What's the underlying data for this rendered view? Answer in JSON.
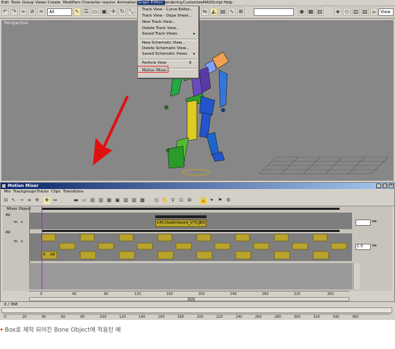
{
  "menubar": {
    "items": [
      "Edit",
      "Tools",
      "Group",
      "Views",
      "Create",
      "Modifiers",
      "Character",
      "reactor",
      "Animation",
      "Graph Editors",
      "Rendering",
      "Customize",
      "MAXScript",
      "Help"
    ]
  },
  "toolbar": {
    "select_filter": "All",
    "view_select": "View"
  },
  "viewport": {
    "label": "Perspective",
    "arrow_color": "#e01010"
  },
  "graph_editors_menu": {
    "items": [
      {
        "label": "Track View - Curve Editor...",
        "shortcut": ""
      },
      {
        "label": "Track View - Dope Sheet...",
        "shortcut": ""
      },
      {
        "label": "New Track View...",
        "shortcut": ""
      },
      {
        "label": "Delete Track View...",
        "shortcut": ""
      },
      {
        "label": "Saved Track Views",
        "shortcut": "▸"
      },
      {
        "label": "New Schematic View...",
        "shortcut": ""
      },
      {
        "label": "Delete Schematic View...",
        "shortcut": ""
      },
      {
        "label": "Saved Schematic Views",
        "shortcut": "▸"
      },
      {
        "label": "Particle View",
        "shortcut": "6"
      },
      {
        "label": "Motion Mixer...",
        "shortcut": ""
      }
    ],
    "highlight_color": "#e03030"
  },
  "motion_mixer": {
    "title": "Motion Mixer",
    "menu": [
      "Mix",
      "Trackgroups",
      "Tracks",
      "Clips",
      "Transitions"
    ],
    "tree_label": "Mixer Object",
    "track1": {
      "name": "All",
      "mute": "m",
      "solo": "s",
      "clip_start": "140",
      "clip_name": "DeathSword_V75_1",
      "clip_end": "200",
      "weight": ""
    },
    "track2": {
      "name": "All",
      "mute": "m",
      "solo": "s",
      "clip_start": "0",
      "clip_end": "16",
      "weight": "1.0"
    },
    "clip_color": "#b8a42c",
    "ruler_ticks": [
      "0",
      "40",
      "80",
      "120",
      "160",
      "200",
      "240",
      "280",
      "320",
      "360"
    ]
  },
  "timeline": {
    "frame_counter": "0 / 368",
    "ticks": [
      "0",
      "20",
      "40",
      "60",
      "80",
      "100",
      "120",
      "140",
      "160",
      "180",
      "200",
      "220",
      "240",
      "260",
      "280",
      "300",
      "320",
      "340",
      "360"
    ]
  },
  "caption": "Box로 제작 되어진 Bone Object에 적용된 예"
}
